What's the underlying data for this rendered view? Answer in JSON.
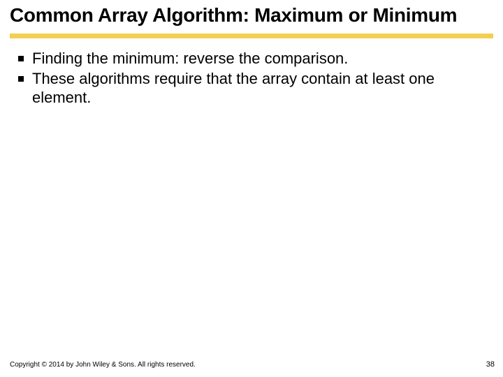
{
  "title": "Common Array Algorithm: Maximum or Minimum",
  "bullets": [
    "Finding the minimum: reverse the comparison.",
    "These algorithms require that the array contain at least one element."
  ],
  "footer": "Copyright © 2014 by John Wiley & Sons. All rights reserved.",
  "pageNumber": "38"
}
